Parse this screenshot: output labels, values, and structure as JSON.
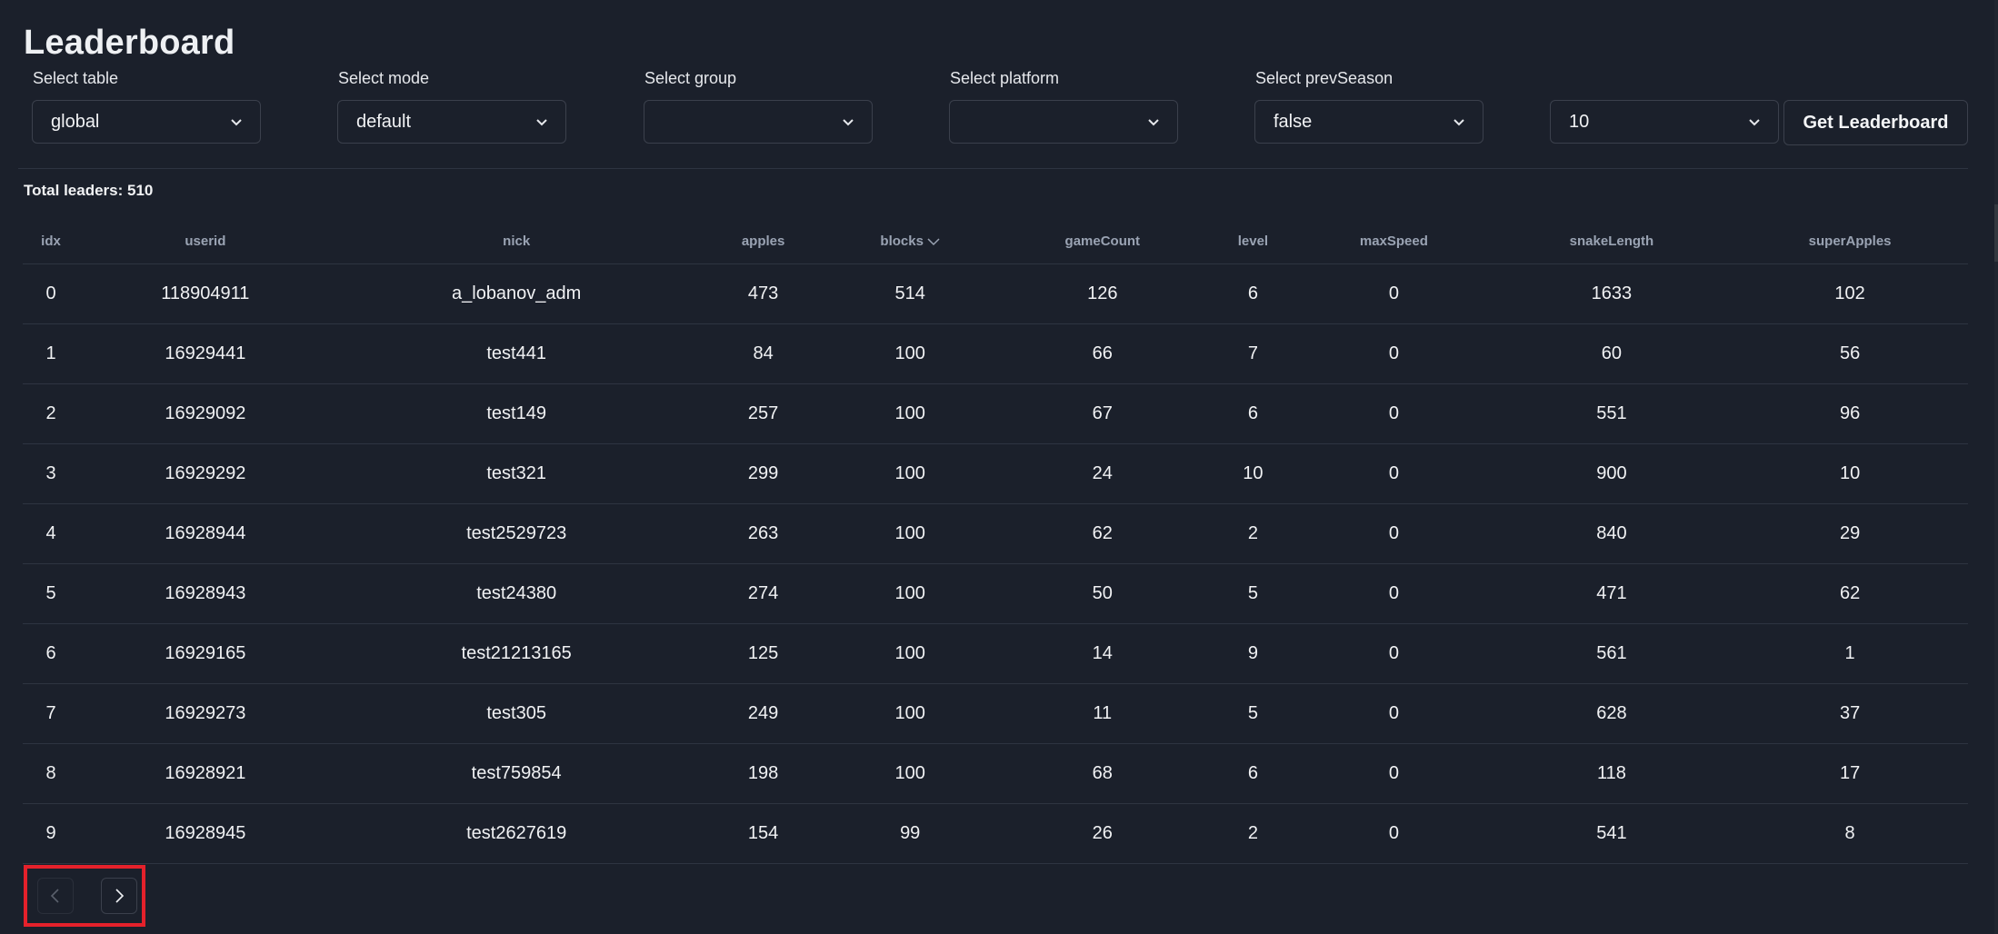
{
  "header": {
    "title": "Leaderboard"
  },
  "filters": [
    {
      "label": "Select table",
      "value": "global"
    },
    {
      "label": "Select mode",
      "value": "default"
    },
    {
      "label": "Select group",
      "value": ""
    },
    {
      "label": "Select platform",
      "value": ""
    },
    {
      "label": "Select prevSeason",
      "value": "false"
    }
  ],
  "limit_select": {
    "value": "10"
  },
  "get_button": {
    "label": "Get Leaderboard"
  },
  "summary": {
    "total_label": "Total leaders: 510"
  },
  "table": {
    "sorted_column": "blocks",
    "sort_direction": "descending",
    "columns": [
      "idx",
      "userid",
      "nick",
      "apples",
      "blocks",
      "gameCount",
      "level",
      "maxSpeed",
      "snakeLength",
      "superApples"
    ],
    "rows": [
      [
        "0",
        "118904911",
        "a_lobanov_adm",
        "473",
        "514",
        "126",
        "6",
        "0",
        "1633",
        "102"
      ],
      [
        "1",
        "16929441",
        "test441",
        "84",
        "100",
        "66",
        "7",
        "0",
        "60",
        "56"
      ],
      [
        "2",
        "16929092",
        "test149",
        "257",
        "100",
        "67",
        "6",
        "0",
        "551",
        "96"
      ],
      [
        "3",
        "16929292",
        "test321",
        "299",
        "100",
        "24",
        "10",
        "0",
        "900",
        "10"
      ],
      [
        "4",
        "16928944",
        "test2529723",
        "263",
        "100",
        "62",
        "2",
        "0",
        "840",
        "29"
      ],
      [
        "5",
        "16928943",
        "test24380",
        "274",
        "100",
        "50",
        "5",
        "0",
        "471",
        "62"
      ],
      [
        "6",
        "16929165",
        "test21213165",
        "125",
        "100",
        "14",
        "9",
        "0",
        "561",
        "1"
      ],
      [
        "7",
        "16929273",
        "test305",
        "249",
        "100",
        "11",
        "5",
        "0",
        "628",
        "37"
      ],
      [
        "8",
        "16928921",
        "test759854",
        "198",
        "100",
        "68",
        "6",
        "0",
        "118",
        "17"
      ],
      [
        "9",
        "16928945",
        "test2627619",
        "154",
        "99",
        "26",
        "2",
        "0",
        "541",
        "8"
      ]
    ]
  },
  "pagination": {
    "prev_icon": "chevron-left-icon",
    "next_icon": "chevron-right-icon",
    "prev_disabled": true,
    "highlight_color": "#e5212b"
  },
  "colors": {
    "background": "#1b202b",
    "border": "#3b404c",
    "header_text": "#9aa3b3",
    "text": "#f1f2f4"
  }
}
